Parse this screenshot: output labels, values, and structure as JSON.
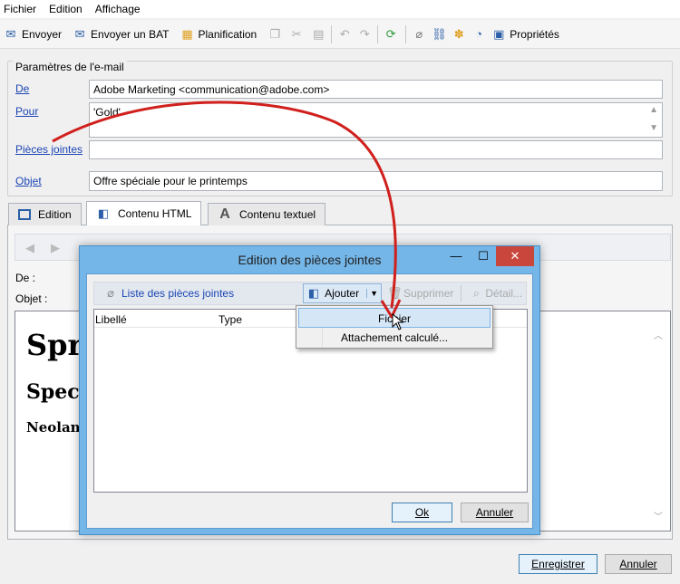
{
  "menu": [
    "Fichier",
    "Edition",
    "Affichage"
  ],
  "toolbar": {
    "send": "Envoyer",
    "send_bat": "Envoyer un BAT",
    "planning": "Planification",
    "properties": "Propriétés"
  },
  "params": {
    "group_title": "Paramètres de l'e-mail",
    "from_label": "De",
    "from_value": "Adobe Marketing <communication@adobe.com>",
    "to_label": "Pour",
    "to_value": "'Gold'",
    "attachments_label": "Pièces jointes",
    "attachments_value": "",
    "subject_label": "Objet",
    "subject_value": "Offre spéciale pour le printemps"
  },
  "tabs": [
    {
      "label": "Edition"
    },
    {
      "label": "Contenu HTML"
    },
    {
      "label": "Contenu textuel"
    }
  ],
  "editor": {
    "from_label": "De :",
    "subject_label": "Objet :",
    "heading1": "Spri",
    "heading2": "Specia",
    "heading3": "Neolanc"
  },
  "dialog": {
    "title": "Edition des pièces jointes",
    "list_label": "Liste des pièces jointes",
    "add": "Ajouter",
    "delete": "Supprimer",
    "detail": "Détail...",
    "col_label": "Libellé",
    "col_type": "Type",
    "ok": "Ok",
    "cancel": "Annuler"
  },
  "dropdown": {
    "items": [
      "Fichier",
      "Attachement calculé..."
    ]
  },
  "footer": {
    "save": "Enregistrer",
    "cancel": "Annuler"
  },
  "colors": {
    "dialog_frame": "#74b6e8",
    "close_button": "#c9463d",
    "arrow": "#d0201d",
    "link": "#1b45b3"
  }
}
